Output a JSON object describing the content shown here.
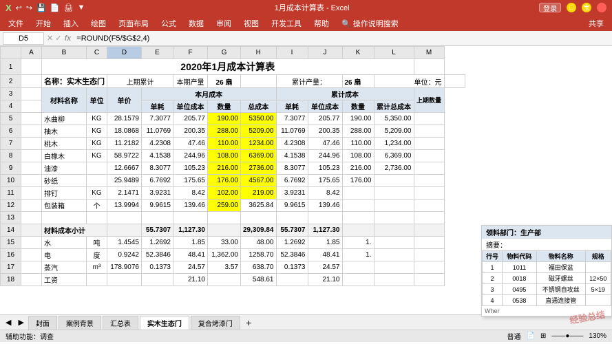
{
  "titleBar": {
    "title": "1月成本计算表 - Excel",
    "loginBtn": "登录",
    "quickAccessBtns": [
      "↩",
      "↪",
      "💾",
      "📄",
      "🖨"
    ]
  },
  "ribbonTabs": [
    "文件",
    "开始",
    "插入",
    "绘图",
    "页面布局",
    "公式",
    "数据",
    "审阅",
    "视图",
    "开发工具",
    "帮助",
    "操作说明搜索"
  ],
  "formulaBar": {
    "cellRef": "D5",
    "formula": "=ROUND(F5/$G$2,4)"
  },
  "spreadsheet": {
    "mainTitle": "2020年1月成本计算表",
    "row2": {
      "name": "名称：实木生态门",
      "cumLabel": "上期累计",
      "currentProdLabel": "本期产量",
      "currentProdVal": "26 扇",
      "cumProdLabel": "累计产量：",
      "cumProdVal": "26 扇",
      "unitLabel": "单位：元"
    },
    "headers": {
      "materialName": "材料名称",
      "unit": "单位",
      "unitPrice": "单价",
      "monthCostLabel": "本月成本",
      "cumCostLabel": "累计成本",
      "singleCons": "单耗",
      "unitCost": "单位成本",
      "qty": "数量",
      "totalCost": "总成本",
      "cumSingleCons": "单耗",
      "cumUnitCost": "单位成本",
      "cumQty": "数量",
      "cumTotalCost": "累计总成本",
      "upQty": "上期数量"
    },
    "rows": [
      {
        "id": 5,
        "name": "水曲柳",
        "unit": "KG",
        "unitPrice": "28.1579",
        "singleCons": "7.3077",
        "unitCost": "205.77",
        "qty": "190.00",
        "totalCost": "5350.00",
        "cumSingleCons": "7.3077",
        "cumUnitCost": "205.77",
        "cumQty": "190.00",
        "cumTotal": "5,350.00",
        "highlight": true
      },
      {
        "id": 6,
        "name": "柚木",
        "unit": "KG",
        "unitPrice": "18.0868",
        "singleCons": "11.0769",
        "unitCost": "200.35",
        "qty": "288.00",
        "totalCost": "5209.00",
        "cumSingleCons": "11.0769",
        "cumUnitCost": "200.35",
        "cumQty": "288.00",
        "cumTotal": "5,209.00",
        "highlight": true
      },
      {
        "id": 7,
        "name": "桃木",
        "unit": "KG",
        "unitPrice": "11.2182",
        "singleCons": "4.2308",
        "unitCost": "47.46",
        "qty": "110.00",
        "totalCost": "1234.00",
        "cumSingleCons": "4.2308",
        "cumUnitCost": "47.46",
        "cumQty": "110.00",
        "cumTotal": "1,234.00",
        "highlight": true
      },
      {
        "id": 8,
        "name": "白橡木",
        "unit": "KG",
        "unitPrice": "58.9722",
        "singleCons": "4.1538",
        "unitCost": "244.96",
        "qty": "108.00",
        "totalCost": "6369.00",
        "cumSingleCons": "4.1538",
        "cumUnitCost": "244.96",
        "cumQty": "108.00",
        "cumTotal": "6,369.00",
        "highlight": true
      },
      {
        "id": 9,
        "name": "油漆",
        "unit": "",
        "unitPrice": "12.6667",
        "singleCons": "8.3077",
        "unitCost": "105.23",
        "qty": "216.00",
        "totalCost": "2736.00",
        "cumSingleCons": "8.3077",
        "cumUnitCost": "105.23",
        "cumQty": "216.00",
        "cumTotal": "2,736.00",
        "highlight": true
      },
      {
        "id": 10,
        "name": "砂纸",
        "unit": "",
        "unitPrice": "25.9489",
        "singleCons": "6.7692",
        "unitCost": "175.65",
        "qty": "176.00",
        "totalCost": "4567.00",
        "cumSingleCons": "6.7692",
        "cumUnitCost": "175.65",
        "cumQty": "176.00",
        "cumTotal": "",
        "highlight": true
      },
      {
        "id": 11,
        "name": "排钉",
        "unit": "KG",
        "unitPrice": "2.1471",
        "singleCons": "3.9231",
        "unitCost": "8.42",
        "qty": "102.00",
        "totalCost": "219.00",
        "cumSingleCons": "3.9231",
        "cumUnitCost": "8.42",
        "cumQty": "",
        "cumTotal": "",
        "highlight": true
      },
      {
        "id": 12,
        "name": "包装箱",
        "unit": "个",
        "unitPrice": "13.9994",
        "singleCons": "9.9615",
        "unitCost": "139.46",
        "qty": "259.00",
        "totalCost": "3625.84",
        "cumSingleCons": "9.9615",
        "cumUnitCost": "139.46",
        "cumQty": "",
        "cumTotal": "",
        "highlight": false
      },
      {
        "id": 13,
        "name": "",
        "unit": "",
        "unitPrice": "",
        "singleCons": "",
        "unitCost": "",
        "qty": "",
        "totalCost": "",
        "cumSingleCons": "",
        "cumUnitCost": "",
        "cumQty": "",
        "cumTotal": "",
        "highlight": false
      },
      {
        "id": 14,
        "name": "材料成本小计",
        "unit": "",
        "unitPrice": "",
        "singleCons": "55.7307",
        "unitCost": "1,127.30",
        "qty": "",
        "totalCost": "29,309.84",
        "cumSingleCons": "55.7307",
        "cumUnitCost": "1,127.30",
        "cumQty": "",
        "cumTotal": "",
        "highlight": false
      },
      {
        "id": 15,
        "name": "水",
        "unit": "吨",
        "unitPrice": "1.4545",
        "singleCons": "1.2692",
        "unitCost": "1.85",
        "qty": "33.00",
        "totalCost": "48.00",
        "cumSingleCons": "1.2692",
        "cumUnitCost": "1.85",
        "cumQty": "1.",
        "cumTotal": "",
        "highlight": false
      },
      {
        "id": 16,
        "name": "电",
        "unit": "度",
        "unitPrice": "0.9242",
        "singleCons": "52.3846",
        "unitCost": "48.41",
        "qty": "1,362.00",
        "totalCost": "1258.70",
        "cumSingleCons": "52.3846",
        "cumUnitCost": "48.41",
        "cumQty": "1.",
        "cumTotal": "",
        "highlight": false
      },
      {
        "id": 17,
        "name": "蒸汽",
        "unit": "m³",
        "unitPrice": "178.9076",
        "singleCons": "0.1373",
        "unitCost": "24.57",
        "qty": "3.57",
        "totalCost": "638.70",
        "cumSingleCons": "0.1373",
        "cumUnitCost": "24.57",
        "cumQty": "",
        "cumTotal": "",
        "highlight": false
      },
      {
        "id": 18,
        "name": "工资",
        "unit": "",
        "unitPrice": "",
        "singleCons": "",
        "unitCost": "21.10",
        "qty": "",
        "totalCost": "548.61",
        "cumSingleCons": "",
        "cumUnitCost": "21.10",
        "cumQty": "",
        "cumTotal": "",
        "highlight": false
      }
    ]
  },
  "sheetTabs": [
    "封面",
    "案例背景",
    "汇总表",
    "实木生态门",
    "复合烤漆门"
  ],
  "activeTab": "实木生态门",
  "statusBar": {
    "left": "辅助功能：调查",
    "right": ""
  },
  "floatPanel": {
    "header": "领料部门：生产部",
    "subheader": "摘要：",
    "columns": [
      "行号",
      "物料代码",
      "物料名称",
      "规格"
    ],
    "rows": [
      [
        "1",
        "1011",
        "福田保盆",
        ""
      ],
      [
        "2",
        "0018",
        "磁牙螺丝",
        "12×50"
      ],
      [
        "3",
        "0495",
        "不锈钢自攻丝",
        "5×19"
      ],
      [
        "4",
        "0538",
        "直通连接管",
        ""
      ]
    ]
  },
  "watermark": "经验总结"
}
